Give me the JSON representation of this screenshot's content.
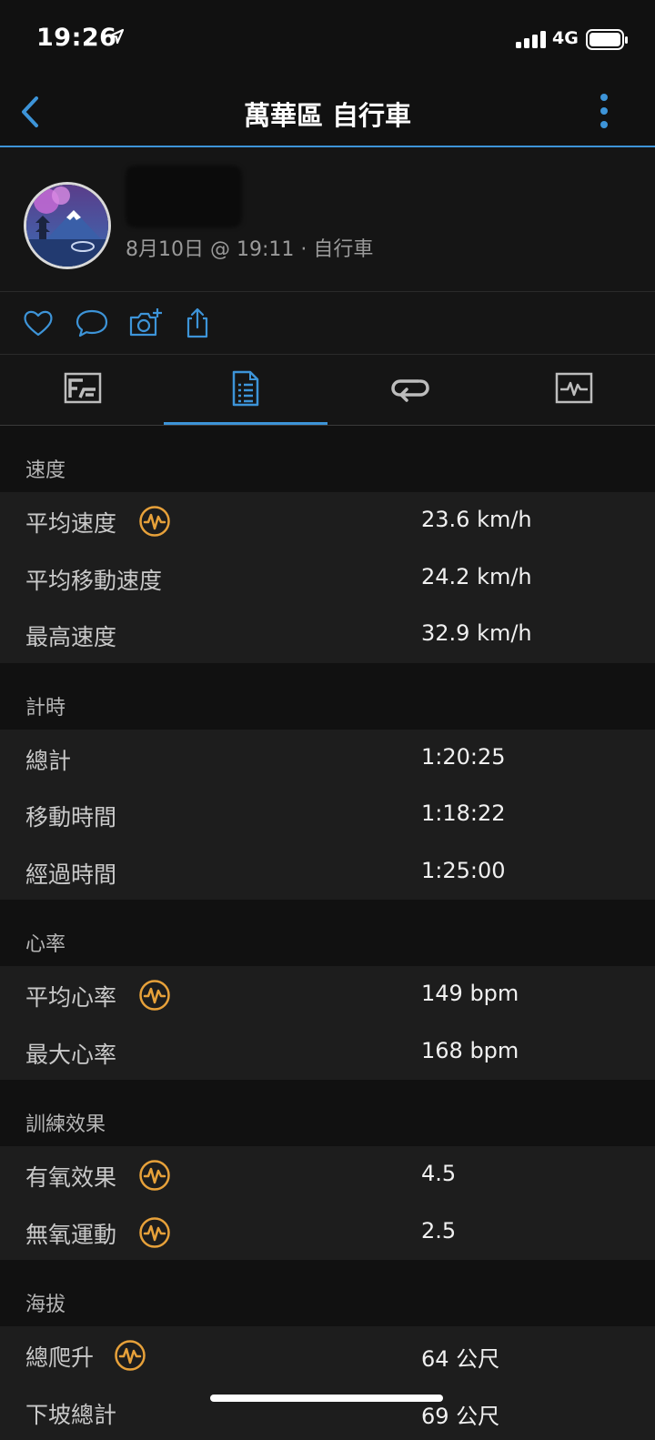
{
  "status_bar": {
    "time": "19:26",
    "network": "4G"
  },
  "header": {
    "title": "萬華區 自行車"
  },
  "profile": {
    "meta": "8月10日 @ 19:11 · 自行車"
  },
  "icons": {
    "back": "chevron-left-icon",
    "more": "more-vertical-icon",
    "like": "heart-icon",
    "comment": "comment-icon",
    "photo": "camera-add-icon",
    "share": "share-icon",
    "tab1": "map-overview-icon",
    "tab2": "stats-document-icon",
    "tab3": "laps-icon",
    "tab4": "chart-icon",
    "metric_badge": "performance-gauge-icon"
  },
  "colors": {
    "accent": "#3d94d8",
    "badge": "#e7a13a",
    "background": "#111111",
    "row": "#1d1d1d"
  },
  "sections": [
    {
      "title": "速度",
      "rows": [
        {
          "label": "平均速度",
          "value": "23.6 km/h",
          "badge": true
        },
        {
          "label": "平均移動速度",
          "value": "24.2 km/h",
          "badge": false
        },
        {
          "label": "最高速度",
          "value": "32.9 km/h",
          "badge": false
        }
      ]
    },
    {
      "title": "計時",
      "rows": [
        {
          "label": "總計",
          "value": "1:20:25",
          "badge": false
        },
        {
          "label": "移動時間",
          "value": "1:18:22",
          "badge": false
        },
        {
          "label": "經過時間",
          "value": "1:25:00",
          "badge": false
        }
      ]
    },
    {
      "title": "心率",
      "rows": [
        {
          "label": "平均心率",
          "value": "149 bpm",
          "badge": true
        },
        {
          "label": "最大心率",
          "value": "168 bpm",
          "badge": false
        }
      ]
    },
    {
      "title": "訓練效果",
      "rows": [
        {
          "label": "有氧效果",
          "value": "4.5",
          "badge": true
        },
        {
          "label": "無氧運動",
          "value": "2.5",
          "badge": true
        }
      ]
    },
    {
      "title": "海拔",
      "rows": [
        {
          "label": "總爬升",
          "value": "64 公尺",
          "badge": true
        },
        {
          "label": "下坡總計",
          "value": "69 公尺",
          "badge": false
        }
      ]
    }
  ]
}
